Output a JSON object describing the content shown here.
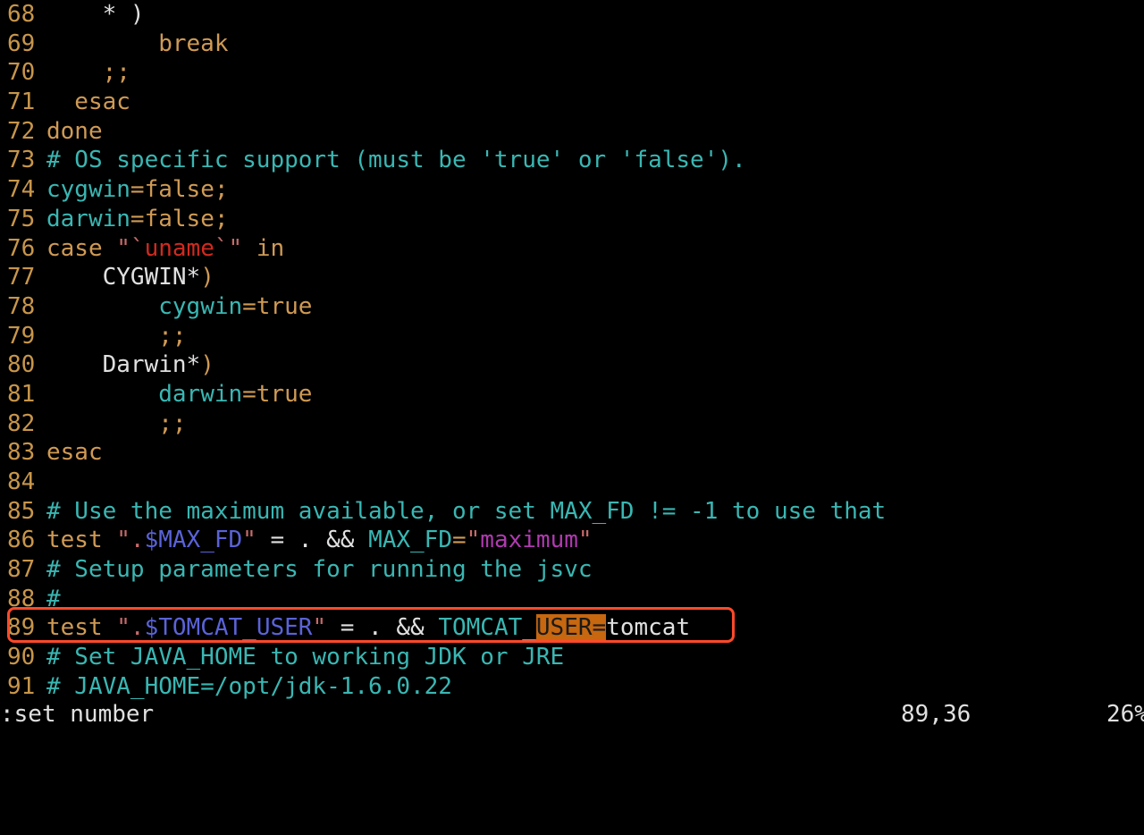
{
  "editor": {
    "lines": [
      {
        "num": "68",
        "tokens": [
          {
            "t": "    * )",
            "c": "plain"
          }
        ]
      },
      {
        "num": "69",
        "tokens": [
          {
            "t": "        break",
            "c": "kw"
          }
        ]
      },
      {
        "num": "70",
        "tokens": [
          {
            "t": "    ;;",
            "c": "kw"
          }
        ]
      },
      {
        "num": "71",
        "tokens": [
          {
            "t": "  esac",
            "c": "kw"
          }
        ]
      },
      {
        "num": "72",
        "tokens": [
          {
            "t": "done",
            "c": "kw"
          }
        ]
      },
      {
        "num": "73",
        "tokens": [
          {
            "t": "# OS specific support (must be 'true' or 'false').",
            "c": "comment"
          }
        ]
      },
      {
        "num": "74",
        "tokens": [
          {
            "t": "cygwin",
            "c": "ident"
          },
          {
            "t": "=false;",
            "c": "kw"
          }
        ]
      },
      {
        "num": "75",
        "tokens": [
          {
            "t": "darwin",
            "c": "ident"
          },
          {
            "t": "=false;",
            "c": "kw"
          }
        ]
      },
      {
        "num": "76",
        "tokens": [
          {
            "t": "case ",
            "c": "kw"
          },
          {
            "t": "\"`",
            "c": "str"
          },
          {
            "t": "uname",
            "c": "red"
          },
          {
            "t": "`\"",
            "c": "str"
          },
          {
            "t": " in",
            "c": "kw"
          }
        ]
      },
      {
        "num": "77",
        "tokens": [
          {
            "t": "    CYGWIN*",
            "c": "plain"
          },
          {
            "t": ")",
            "c": "kw"
          }
        ]
      },
      {
        "num": "78",
        "tokens": [
          {
            "t": "        ",
            "c": "plain"
          },
          {
            "t": "cygwin",
            "c": "ident"
          },
          {
            "t": "=true",
            "c": "kw"
          }
        ]
      },
      {
        "num": "79",
        "tokens": [
          {
            "t": "        ;;",
            "c": "kw"
          }
        ]
      },
      {
        "num": "80",
        "tokens": [
          {
            "t": "    Darwin*",
            "c": "plain"
          },
          {
            "t": ")",
            "c": "kw"
          }
        ]
      },
      {
        "num": "81",
        "tokens": [
          {
            "t": "        ",
            "c": "plain"
          },
          {
            "t": "darwin",
            "c": "ident"
          },
          {
            "t": "=true",
            "c": "kw"
          }
        ]
      },
      {
        "num": "82",
        "tokens": [
          {
            "t": "        ;;",
            "c": "kw"
          }
        ]
      },
      {
        "num": "83",
        "tokens": [
          {
            "t": "esac",
            "c": "kw"
          }
        ]
      },
      {
        "num": "84",
        "tokens": []
      },
      {
        "num": "85",
        "tokens": [
          {
            "t": "# Use the maximum available, or set MAX_FD != -1 to use that",
            "c": "comment"
          }
        ]
      },
      {
        "num": "86",
        "tokens": [
          {
            "t": "test ",
            "c": "kw"
          },
          {
            "t": "\".",
            "c": "str"
          },
          {
            "t": "$MAX_FD",
            "c": "var"
          },
          {
            "t": "\"",
            "c": "str"
          },
          {
            "t": " = . && ",
            "c": "plain"
          },
          {
            "t": "MAX_FD",
            "c": "ident"
          },
          {
            "t": "=",
            "c": "kw"
          },
          {
            "t": "\"",
            "c": "str"
          },
          {
            "t": "maximum",
            "c": "mag"
          },
          {
            "t": "\"",
            "c": "str"
          }
        ]
      },
      {
        "num": "87",
        "tokens": [
          {
            "t": "# Setup parameters for running the jsvc",
            "c": "comment"
          }
        ]
      },
      {
        "num": "88",
        "tokens": [
          {
            "t": "#",
            "c": "comment"
          }
        ]
      },
      {
        "num": "89",
        "tokens": [
          {
            "t": "test ",
            "c": "kw"
          },
          {
            "t": "\".",
            "c": "str"
          },
          {
            "t": "$TOMCAT_USER",
            "c": "var"
          },
          {
            "t": "\"",
            "c": "str"
          },
          {
            "t": " = . && ",
            "c": "plain"
          },
          {
            "t": "TOMCAT_",
            "c": "ident"
          },
          {
            "t": "USER=",
            "c": "cursor-hl"
          },
          {
            "t": "tomcat",
            "c": "plain"
          }
        ]
      },
      {
        "num": "90",
        "tokens": [
          {
            "t": "# Set JAVA_HOME to working JDK or JRE",
            "c": "comment"
          }
        ]
      },
      {
        "num": "91",
        "tokens": [
          {
            "t": "# JAVA_HOME=/opt/jdk-1.6.0.22",
            "c": "comment"
          }
        ]
      }
    ]
  },
  "status": {
    "command": ":set number",
    "cursor_position": "89,36",
    "scroll_percent": "26%"
  },
  "highlight": {
    "line_num": "89",
    "color": "#ff4a2a"
  },
  "colors": {
    "background": "#000000",
    "line_numbers": "#c8964a",
    "comment": "#39b7b3",
    "keyword": "#cf9a54",
    "variable": "#5a63d8",
    "string": "#c76a6a",
    "magenta": "#b03ab0",
    "cursor_highlight": "#c7670f"
  }
}
